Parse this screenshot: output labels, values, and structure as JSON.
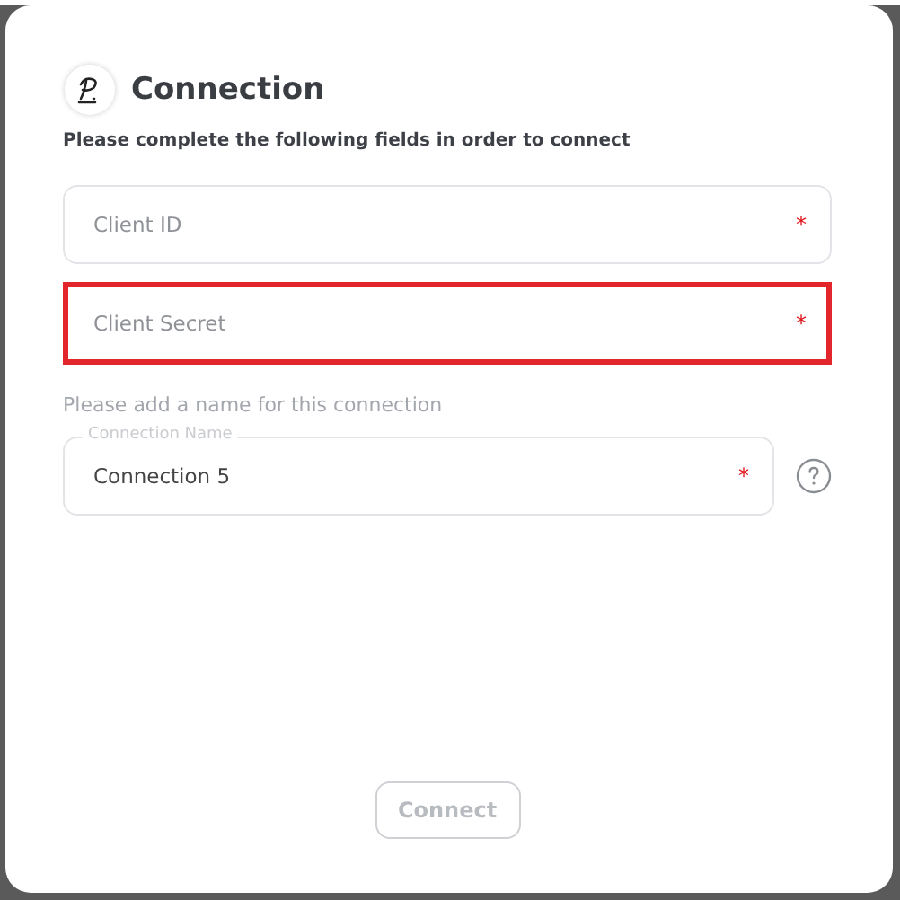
{
  "dialog": {
    "title": "Connection",
    "subtitle": "Please complete the following fields in order to connect",
    "fields": [
      {
        "placeholder": "Client ID",
        "required_mark": "*",
        "highlighted": false
      },
      {
        "placeholder": "Client Secret",
        "required_mark": "*",
        "highlighted": true
      }
    ],
    "name_hint": "Please add a name for this connection",
    "name_field": {
      "label": "Connection Name",
      "value": "Connection 5",
      "required_mark": "*"
    },
    "connect_button": {
      "label": "Connect",
      "disabled": true
    }
  }
}
